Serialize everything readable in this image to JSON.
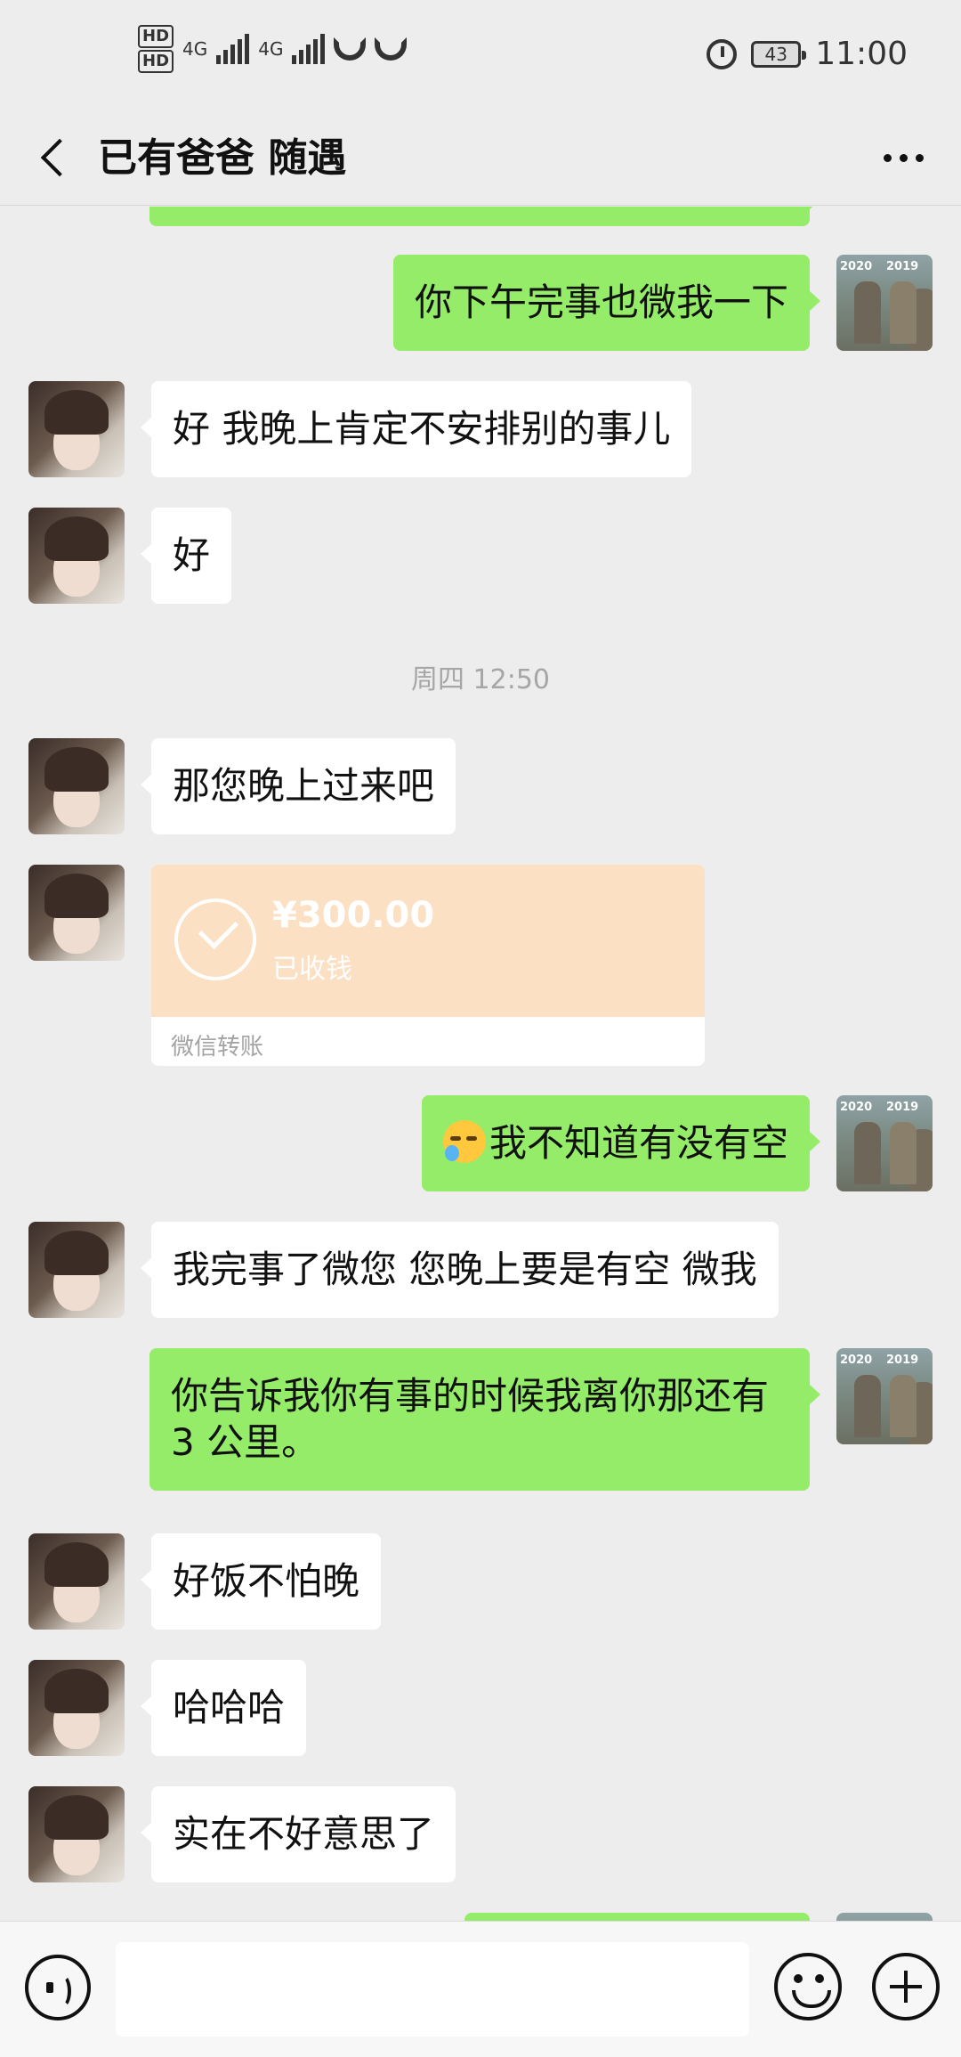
{
  "status_bar": {
    "hd1": "HD",
    "hd2": "HD",
    "net1": "4G",
    "net2": "4G",
    "battery": "43",
    "time": "11:00"
  },
  "header": {
    "title": "已有爸爸 随遇"
  },
  "messages": [
    {
      "from": "me",
      "text": "你下午完事也微我一下"
    },
    {
      "from": "them",
      "text": "好 我晚上肯定不安排别的事儿"
    },
    {
      "from": "them",
      "text": "好"
    },
    {
      "type": "timestamp",
      "text": "周四 12:50"
    },
    {
      "from": "them",
      "text": "那您晚上过来吧"
    },
    {
      "from": "them",
      "type": "transfer",
      "amount": "¥300.00",
      "status": "已收钱",
      "footer": "微信转账"
    },
    {
      "from": "me",
      "text": "我不知道有没有空",
      "emoji": "crying-laughing"
    },
    {
      "from": "them",
      "text": "我完事了微您 您晚上要是有空 微我"
    },
    {
      "from": "me",
      "text": "你告诉我你有事的时候我离你那还有 3 公里。"
    },
    {
      "from": "them",
      "text": "好饭不怕晚"
    },
    {
      "from": "them",
      "text": "哈哈哈"
    },
    {
      "from": "them",
      "text": "实在不好意思了"
    }
  ],
  "my_avatar": {
    "label_left": "2020",
    "label_right": "2019"
  },
  "colors": {
    "background": "#ededed",
    "my_bubble": "#95ec69",
    "their_bubble": "#ffffff",
    "transfer_card": "#fbe0c3"
  }
}
